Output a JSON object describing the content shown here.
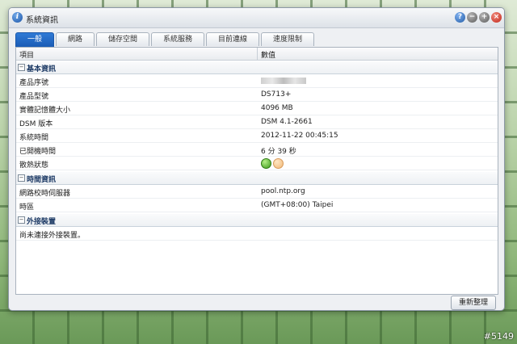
{
  "window": {
    "title": "系統資訊"
  },
  "tabs": [
    {
      "label": "一般",
      "active": true
    },
    {
      "label": "網路",
      "active": false
    },
    {
      "label": "儲存空間",
      "active": false
    },
    {
      "label": "系統服務",
      "active": false
    },
    {
      "label": "目前連線",
      "active": false
    },
    {
      "label": "速度限制",
      "active": false
    }
  ],
  "columns": {
    "key": "項目",
    "value": "數值"
  },
  "groups": {
    "basic": {
      "title": "基本資訊",
      "rows": [
        {
          "key": "產品序號",
          "value": ""
        },
        {
          "key": "產品型號",
          "value": "DS713+"
        },
        {
          "key": "實體記憶體大小",
          "value": "4096 MB"
        },
        {
          "key": "DSM 版本",
          "value": "DSM 4.1-2661"
        },
        {
          "key": "系統時間",
          "value": "2012-11-22 00:45:15"
        },
        {
          "key": "已開機時間",
          "value": "6 分 39 秒"
        },
        {
          "key": "散熱狀態",
          "value": ""
        }
      ]
    },
    "time": {
      "title": "時間資訊",
      "rows": [
        {
          "key": "網路校時伺服器",
          "value": "pool.ntp.org"
        },
        {
          "key": "時區",
          "value": "(GMT+08:00) Taipei"
        }
      ]
    },
    "external": {
      "title": "外接裝置",
      "rows": [
        {
          "key": "尚未連接外接裝置。",
          "value": ""
        }
      ]
    }
  },
  "toggle_symbol": "−",
  "footer": {
    "refresh_label": "重新整理"
  },
  "watermark": "#5149",
  "colors": {
    "accent": "#1b5cb5",
    "led_green": "#3d9a1c",
    "led_orange": "#f0b877"
  },
  "icons": {
    "app": "info-icon",
    "help": "help-icon",
    "minimize": "minimize-icon",
    "maximize": "maximize-icon",
    "close": "close-icon"
  }
}
